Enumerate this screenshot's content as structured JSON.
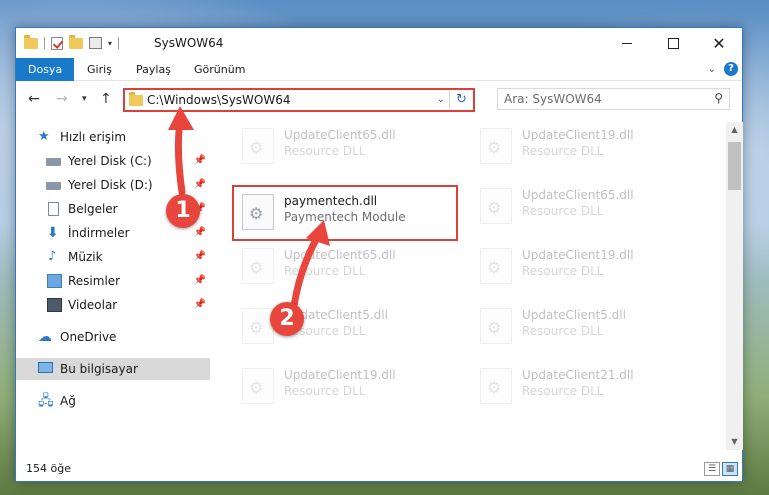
{
  "window": {
    "title": "SysWOW64"
  },
  "ribbon": {
    "tabs": [
      {
        "label": "Dosya",
        "active": true
      },
      {
        "label": "Giriş",
        "active": false
      },
      {
        "label": "Paylaş",
        "active": false
      },
      {
        "label": "Görünüm",
        "active": false
      }
    ]
  },
  "address": {
    "path": "C:\\Windows\\SysWOW64"
  },
  "search": {
    "placeholder": "Ara: SysWOW64"
  },
  "sidebar": {
    "items": [
      {
        "label": "Hızlı erişim",
        "icon": "star-icon",
        "pinned": false
      },
      {
        "label": "Yerel Disk (C:)",
        "icon": "disk-icon",
        "pinned": true
      },
      {
        "label": "Yerel Disk (D:)",
        "icon": "disk-icon",
        "pinned": true
      },
      {
        "label": "Belgeler",
        "icon": "document-icon",
        "pinned": true
      },
      {
        "label": "İndirmeler",
        "icon": "download-icon",
        "pinned": true
      },
      {
        "label": "Müzik",
        "icon": "music-icon",
        "pinned": true
      },
      {
        "label": "Resimler",
        "icon": "pictures-icon",
        "pinned": true
      },
      {
        "label": "Videolar",
        "icon": "videos-icon",
        "pinned": true
      },
      {
        "label": "OneDrive",
        "icon": "cloud-icon",
        "pinned": false
      },
      {
        "label": "Bu bilgisayar",
        "icon": "computer-icon",
        "pinned": false,
        "selected": true
      },
      {
        "label": "Ağ",
        "icon": "network-icon",
        "pinned": false
      }
    ]
  },
  "files": [
    {
      "name": "UpdateClient65.dll",
      "type": "Resource DLL"
    },
    {
      "name": "UpdateClient19.dll",
      "type": "Resource DLL"
    },
    {
      "name": "paymentech.dll",
      "type": "Paymentech Module",
      "highlighted": true
    },
    {
      "name": "UpdateClient65.dll",
      "type": "Resource DLL"
    },
    {
      "name": "UpdateClient65.dll",
      "type": "Resource DLL"
    },
    {
      "name": "UpdateClient19.dll",
      "type": "Resource DLL"
    },
    {
      "name": "UpdateClient5.dll",
      "type": "Resource DLL"
    },
    {
      "name": "UpdateClient5.dll",
      "type": "Resource DLL"
    },
    {
      "name": "UpdateClient19.dll",
      "type": "Resource DLL"
    },
    {
      "name": "UpdateClient21.dll",
      "type": "Resource DLL"
    }
  ],
  "status": {
    "item_count": "154 öğe"
  },
  "annotations": {
    "step1": "1",
    "step2": "2",
    "accent": "#e8453c"
  }
}
